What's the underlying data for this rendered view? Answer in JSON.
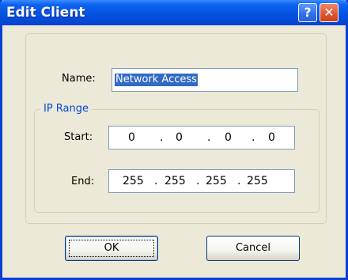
{
  "window": {
    "title": "Edit Client",
    "help_glyph": "?",
    "close_glyph": "✕"
  },
  "form": {
    "name_label": "Name:",
    "name_value": "Network Access",
    "ip_range_legend": "IP Range",
    "start_label": "Start:",
    "start_ip": [
      "0",
      "0",
      "0",
      "0"
    ],
    "end_label": "End:",
    "end_ip": [
      "255",
      "255",
      "255",
      "255"
    ],
    "dot": "."
  },
  "buttons": {
    "ok": "OK",
    "cancel": "Cancel"
  },
  "colors": {
    "titlebar": "#0553E1",
    "dialog_bg": "#ECE9D8",
    "legend_text": "#0046D5",
    "selection": "#316AC5"
  }
}
